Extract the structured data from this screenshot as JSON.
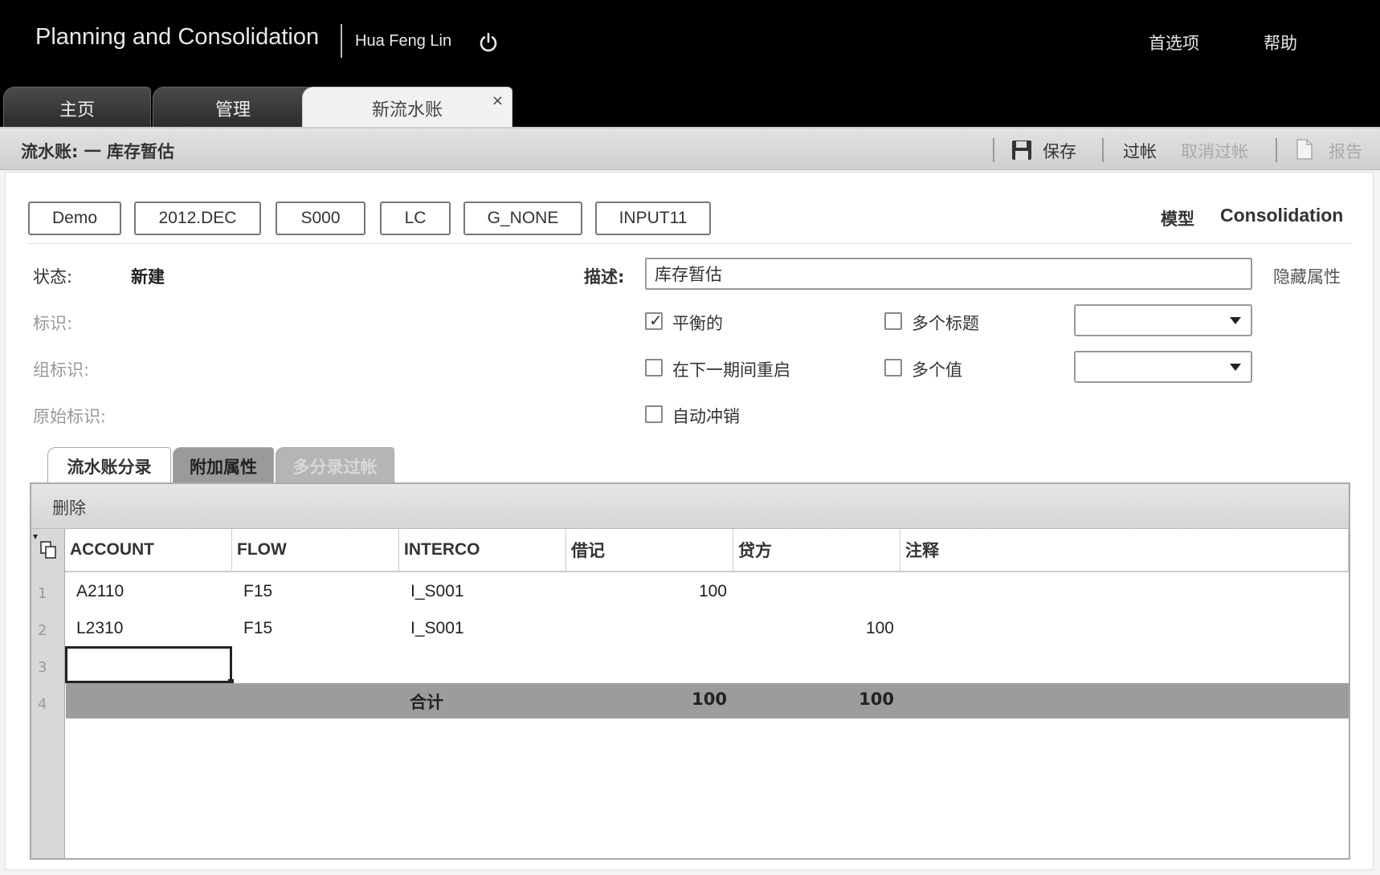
{
  "header": {
    "app_title": "Planning and Consolidation",
    "user_name": "Hua Feng Lin",
    "preferences": "首选项",
    "help": "帮助"
  },
  "tabs": [
    {
      "label": "主页"
    },
    {
      "label": "管理"
    },
    {
      "label": "新流水账",
      "close": "×"
    }
  ],
  "toolbar": {
    "title": "流水账: 一 库存暂估",
    "save": "保存",
    "post": "过帐",
    "unpost": "取消过帐",
    "report": "报告"
  },
  "pov": [
    "Demo",
    "2012.DEC",
    "S000",
    "LC",
    "G_NONE",
    "INPUT11"
  ],
  "model": {
    "label": "模型",
    "value": "Consolidation"
  },
  "form": {
    "status_label": "状态:",
    "status_value": "新建",
    "id_label": "标识:",
    "group_id_label": "组标识:",
    "original_id_label": "原始标识:",
    "desc_label": "描述:",
    "desc_value": "库存暂估",
    "hide_attributes": "隐藏属性",
    "balanced_label": "平衡的",
    "balanced_checked": true,
    "reopen_label": "在下一期间重启",
    "reopen_checked": false,
    "auto_reverse_label": "自动冲销",
    "auto_reverse_checked": false,
    "multi_header_label": "多个标题",
    "multi_header_checked": false,
    "multi_value_label": "多个值",
    "multi_value_checked": false,
    "dropdown1_value": "",
    "dropdown2_value": ""
  },
  "subtabs": [
    {
      "label": "流水账分录",
      "state": "active"
    },
    {
      "label": "附加属性",
      "state": "normal"
    },
    {
      "label": "多分录过帐",
      "state": "disabled"
    }
  ],
  "grid": {
    "delete": "删除",
    "menu_glyph": "▾",
    "columns": [
      "ACCOUNT",
      "FLOW",
      "INTERCO",
      "借记",
      "贷方",
      "注释"
    ],
    "row_numbers": [
      "1",
      "2",
      "3",
      "4"
    ],
    "rows": [
      {
        "account": "A2110",
        "flow": "F15",
        "interco": "I_S001",
        "debit": "100",
        "credit": "",
        "comment": ""
      },
      {
        "account": "L2310",
        "flow": "F15",
        "interco": "I_S001",
        "debit": "",
        "credit": "100",
        "comment": ""
      }
    ],
    "total": {
      "label": "合计",
      "debit": "100",
      "credit": "100"
    }
  }
}
